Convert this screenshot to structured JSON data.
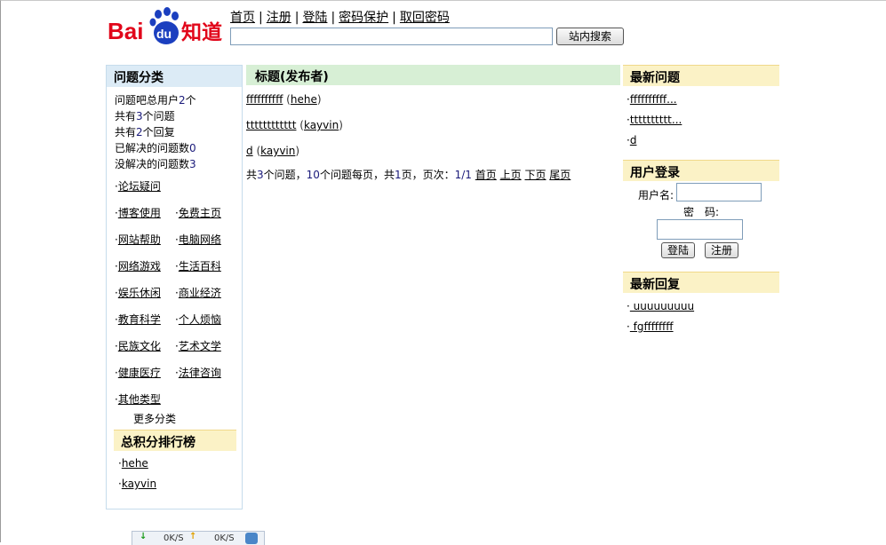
{
  "header": {
    "logo_text": "Bai du 知道",
    "nav": [
      "首页",
      "注册",
      "登陆",
      "密码保护",
      "取回密码"
    ],
    "search_button": "站内搜索"
  },
  "left": {
    "title": "问题分类",
    "stats": [
      {
        "prefix": "问题吧总用户",
        "num": "2",
        "suffix": "个"
      },
      {
        "prefix": "共有",
        "num": "3",
        "suffix": "个问题"
      },
      {
        "prefix": "共有",
        "num": "2",
        "suffix": "个回复"
      },
      {
        "prefix": "已解决的问题数",
        "num": "0",
        "suffix": ""
      },
      {
        "prefix": "没解决的问题数",
        "num": "3",
        "suffix": ""
      }
    ],
    "categories": [
      "论坛疑问",
      "博客使用",
      "免费主页",
      "网站帮助",
      "电脑网络",
      "网络游戏",
      "生活百科",
      "娱乐休闲",
      "商业经济",
      "教育科学",
      "个人烦恼",
      "民族文化",
      "艺术文学",
      "健康医疗",
      "法律咨询",
      "其他类型"
    ],
    "more": "更多分类",
    "rank_title": "总积分排行榜",
    "rank": [
      "hehe",
      "kayvin"
    ]
  },
  "center": {
    "title": "标题(发布者)",
    "questions": [
      {
        "title": "ffffffffff",
        "author": "hehe"
      },
      {
        "title": "tttttttttttt",
        "author": "kayvin"
      },
      {
        "title": "d",
        "author": "kayvin"
      }
    ],
    "pager": {
      "text1": "共",
      "total": "3",
      "text2": "个问题，",
      "per": "10",
      "text3": "个问题每页，共",
      "pages": "1",
      "text4": "页，页次：",
      "cur": "1/1",
      "links": [
        "首页",
        "上页",
        "下页",
        "尾页"
      ]
    }
  },
  "right": {
    "latest_title": "最新问题",
    "latest": [
      "ffffffffff...",
      "tttttttttt...",
      "d"
    ],
    "login_title": "用户登录",
    "username_label": "用户名:",
    "password_label": "密　码:",
    "login_button": "登陆",
    "register_button": "注册",
    "reply_title": "最新回复",
    "replies": [
      " uuuuuuuuu ",
      " fgffffffff "
    ]
  },
  "statusbar": {
    "down": "0K/S",
    "up": "0K/S"
  },
  "colors": {
    "left_head": "#dcebf6",
    "center_head": "#d7efd5",
    "right_head": "#fbf2c6",
    "number_blue": "#1a1a7a"
  }
}
